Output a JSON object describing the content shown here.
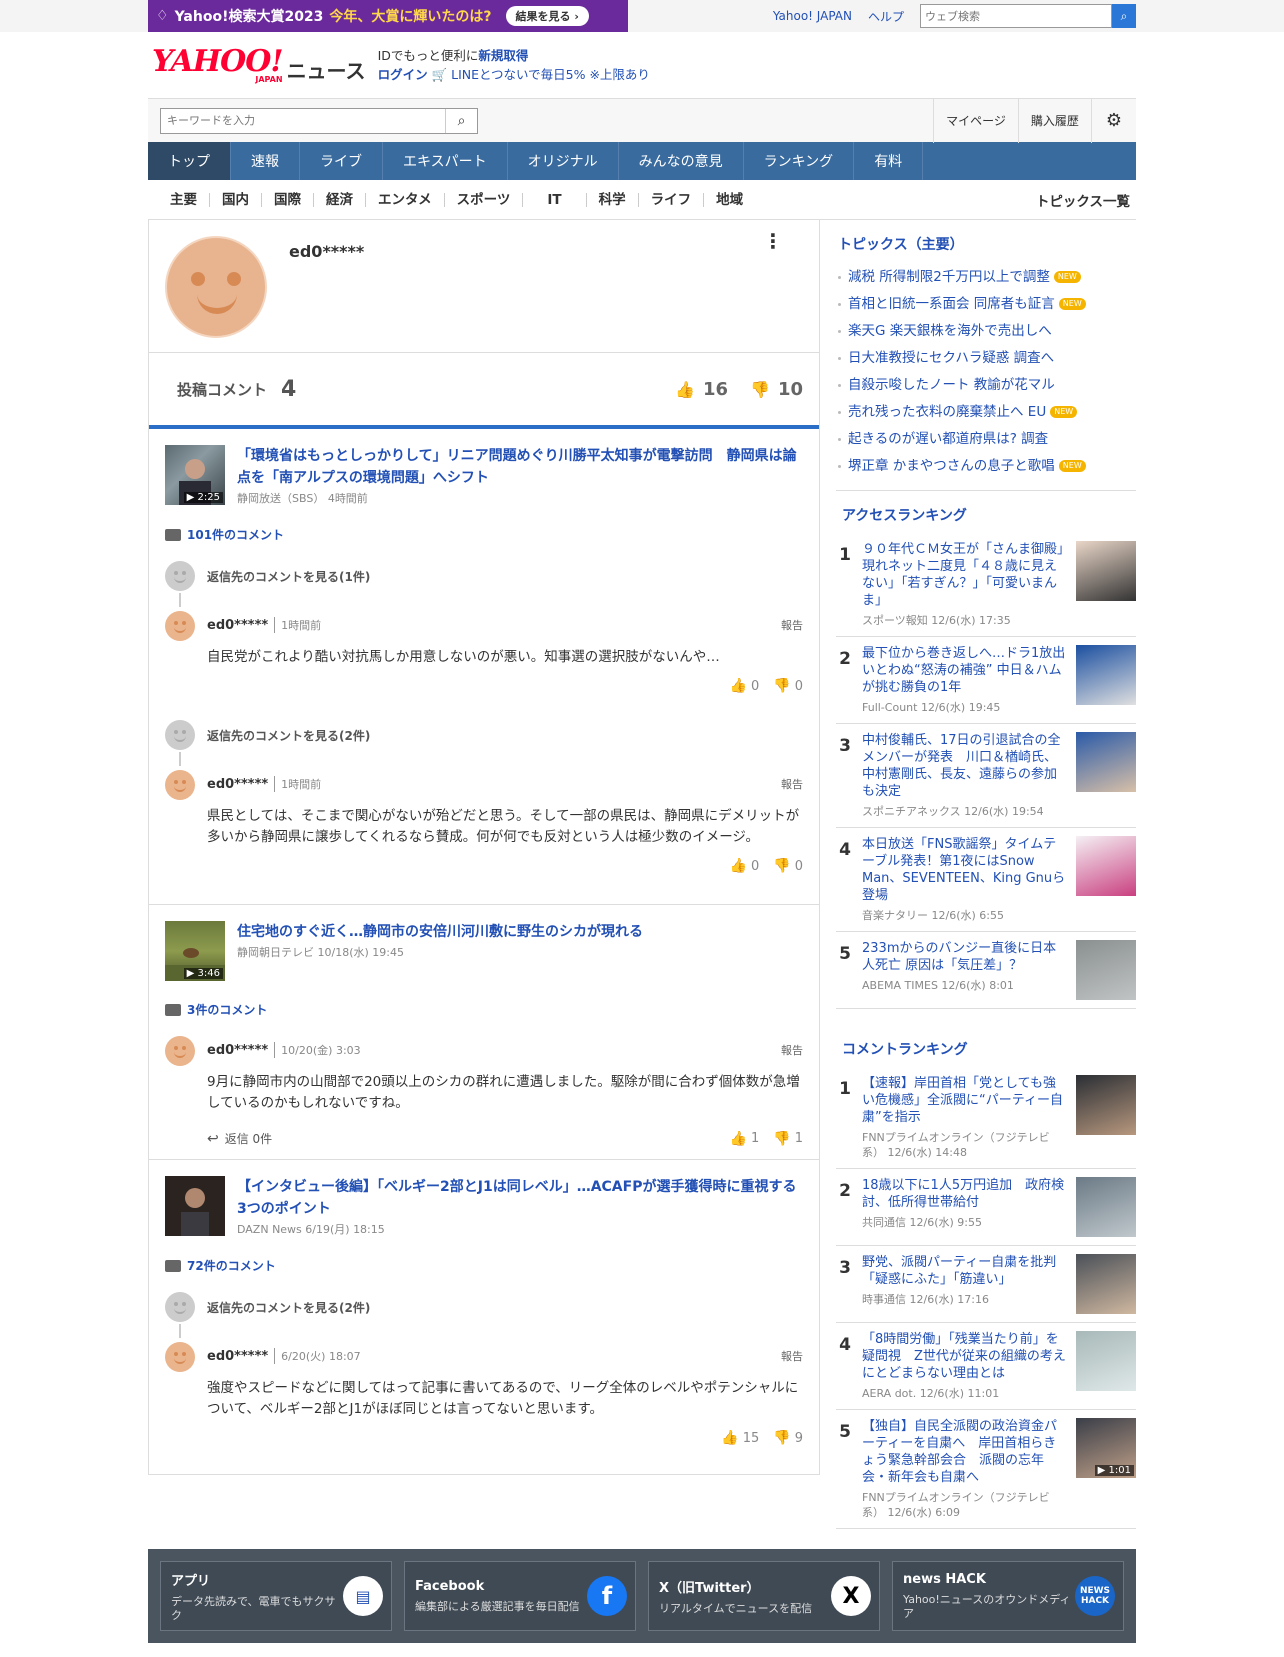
{
  "topbar": {
    "banner": {
      "part1": "Yahoo!検索大賞2023",
      "part2": "今年、大賞に輝いたのは?",
      "button": "結果を見る ›"
    },
    "links": [
      "Yahoo! JAPAN",
      "ヘルプ"
    ],
    "websearch_placeholder": "ウェブ検索"
  },
  "header": {
    "logo": "YAHOO!",
    "logo_sub": "JAPAN",
    "service": "ニュース",
    "line1_a": "IDでもっと便利に",
    "line1_b": "新規取得",
    "line2_a": "ログイン",
    "line2_b": "LINEとつないで毎日5% ※上限あり"
  },
  "searchbar": {
    "placeholder": "キーワードを入力",
    "links": [
      "マイページ",
      "購入履歴"
    ]
  },
  "nav": [
    "トップ",
    "速報",
    "ライブ",
    "エキスパート",
    "オリジナル",
    "みんなの意見",
    "ランキング",
    "有料"
  ],
  "subnav": [
    "主要",
    "国内",
    "国際",
    "経済",
    "エンタメ",
    "スポーツ",
    "IT",
    "科学",
    "ライフ",
    "地域"
  ],
  "subnav_all": "トピックス一覧",
  "profile": {
    "username": "ed0*****",
    "posted_label": "投稿コメント",
    "posted_count": "4",
    "likes": "16",
    "dislikes": "10"
  },
  "articles": [
    {
      "title": "「環境省はもっとしっかりして」リニア問題めぐり川勝平太知事が電撃訪問　静岡県は論点を「南アルプスの環境問題」へシフト",
      "meta": "静岡放送（SBS） 4時間前",
      "duration": "▶ 2:25",
      "comment_count": "101件のコメント",
      "comments": [
        {
          "reply_link": "返信先のコメントを見る(1件)",
          "user": "ed0*****",
          "time": "1時間前",
          "report": "報告",
          "text": "自民党がこれより酷い対抗馬しか用意しないのが悪い。知事選の選択肢がないんや…",
          "up": "0",
          "down": "0"
        },
        {
          "reply_link": "返信先のコメントを見る(2件)",
          "user": "ed0*****",
          "time": "1時間前",
          "report": "報告",
          "text": "県民としては、そこまで関心がないが殆どだと思う。そして一部の県民は、静岡県にデメリットが多いから静岡県に譲歩してくれるなら賛成。何が何でも反対という人は極少数のイメージ。",
          "up": "0",
          "down": "0"
        }
      ]
    },
    {
      "title": "住宅地のすぐ近く…静岡市の安倍川河川敷に野生のシカが現れる",
      "meta": "静岡朝日テレビ 10/18(水) 19:45",
      "duration": "▶ 3:46",
      "comment_count": "3件のコメント",
      "comments": [
        {
          "user": "ed0*****",
          "time": "10/20(金) 3:03",
          "report": "報告",
          "text": "9月に静岡市内の山間部で20頭以上のシカの群れに遭遇しました。駆除が間に合わず個体数が急増しているのかもしれないですね。",
          "reply_count": "返信 0件",
          "up": "1",
          "down": "1"
        }
      ]
    },
    {
      "title": "【インタビュー後編】「ベルギー2部とJ1は同レベル」…ACAFPが選手獲得時に重視する3つのポイント",
      "meta": "DAZN News 6/19(月) 18:15",
      "comment_count": "72件のコメント",
      "comments": [
        {
          "reply_link": "返信先のコメントを見る(2件)",
          "user": "ed0*****",
          "time": "6/20(火) 18:07",
          "report": "報告",
          "text": "強度やスピードなどに関してはって記事に書いてあるので、リーグ全体のレベルやポテンシャルについて、ベルギー2部とJ1がほぼ同じとは言ってないと思います。",
          "up": "15",
          "down": "9"
        }
      ]
    }
  ],
  "topics": {
    "heading": "トピックス（主要）",
    "new_label": "NEW",
    "items": [
      {
        "t": "減税 所得制限2千万円以上で調整",
        "new": true
      },
      {
        "t": "首相と旧統一系面会 同席者も証言",
        "new": true
      },
      {
        "t": "楽天G 楽天銀株を海外で売出しへ",
        "new": false
      },
      {
        "t": "日大准教授にセクハラ疑惑 調査へ",
        "new": false
      },
      {
        "t": "自殺示唆したノート 教諭が花マル",
        "new": false
      },
      {
        "t": "売れ残った衣料の廃棄禁止へ EU",
        "new": true
      },
      {
        "t": "起きるのが遅い都道府県は? 調査",
        "new": false
      },
      {
        "t": "堺正章 かまやつさんの息子と歌唱",
        "new": true
      }
    ]
  },
  "access_ranking": {
    "heading": "アクセスランキング",
    "items": [
      {
        "n": "1",
        "t": "９０年代ＣＭ女王が「さんま御殿」現れネット二度見「４８歳に見えない」「若すぎん？」「可愛いまんま」",
        "s": "スポーツ報知 12/6(水) 17:35"
      },
      {
        "n": "2",
        "t": "最下位から巻き返しへ…ドラ1放出いとわぬ“怒涛の補強” 中日＆ハムが挑む勝負の1年",
        "s": "Full-Count 12/6(水) 19:45"
      },
      {
        "n": "3",
        "t": "中村俊輔氏、17日の引退試合の全メンバーが発表　川口＆楢崎氏、中村憲剛氏、長友、遠藤らの参加も決定",
        "s": "スポニチアネックス 12/6(水) 19:54"
      },
      {
        "n": "4",
        "t": "本日放送「FNS歌謡祭」タイムテーブル発表！第1夜にはSnow Man、SEVENTEEN、King Gnuら登場",
        "s": "音楽ナタリー 12/6(水) 6:55"
      },
      {
        "n": "5",
        "t": "233mからのバンジー直後に日本人死亡 原因は「気圧差」？",
        "s": "ABEMA TIMES 12/6(水) 8:01"
      }
    ]
  },
  "comment_ranking": {
    "heading": "コメントランキング",
    "items": [
      {
        "n": "1",
        "t": "【速報】岸田首相「党としても強い危機感」全派閥に“パーティー自粛”を指示",
        "s": "FNNプライムオンライン（フジテレビ系） 12/6(水) 14:48"
      },
      {
        "n": "2",
        "t": "18歳以下に1人5万円追加　政府検討、低所得世帯給付",
        "s": "共同通信 12/6(水) 9:55"
      },
      {
        "n": "3",
        "t": "野党、派閥パーティー自粛を批判 「疑惑にふた」「筋違い」",
        "s": "時事通信 12/6(水) 17:16"
      },
      {
        "n": "4",
        "t": "「8時間労働」「残業当たり前」を疑問視　Z世代が従来の組織の考えにとどまらない理由とは",
        "s": "AERA dot. 12/6(水) 11:01"
      },
      {
        "n": "5",
        "t": "【独自】自民全派閥の政治資金パーティーを自粛へ　岸田首相らきょう緊急幹部会合　派閥の忘年会・新年会も自粛へ",
        "s": "FNNプライムオンライン（フジテレビ系） 12/6(水) 6:09",
        "duration": "▶ 1:01"
      }
    ]
  },
  "footer": [
    {
      "h": "アプリ",
      "d": "データ先読みで、電車でもサクサク"
    },
    {
      "h": "Facebook",
      "d": "編集部による厳選記事を毎日配信"
    },
    {
      "h": "X（旧Twitter）",
      "d": "リアルタイムでニュースを配信"
    },
    {
      "h": "news HACK",
      "d": "Yahoo!ニュースのオウンドメディア"
    }
  ]
}
